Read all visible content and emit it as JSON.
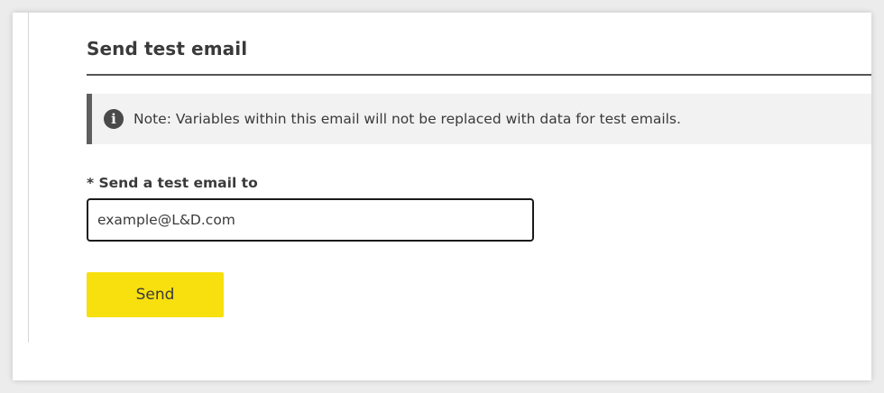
{
  "section": {
    "title": "Send test email"
  },
  "notice": {
    "icon": "info-icon",
    "icon_glyph": "i",
    "text": "Note: Variables within this email will not be replaced with data for test emails."
  },
  "form": {
    "label": "* Send a test email to",
    "email_value": "example@L&D.com"
  },
  "actions": {
    "send_label": "Send"
  },
  "colors": {
    "button_accent": "#f8e00e",
    "notice_background": "#f2f2f2",
    "notice_border": "#5f5f5f"
  }
}
